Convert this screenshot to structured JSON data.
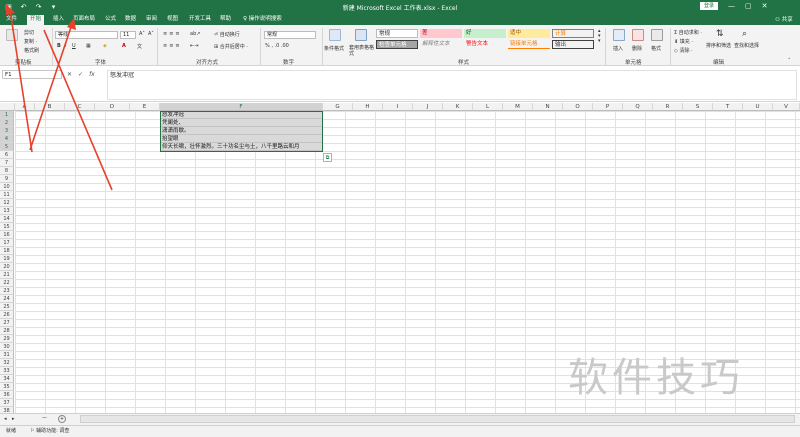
{
  "titlebar": {
    "title": "新建 Microsoft Excel 工作表.xlsx  -  Excel",
    "login": "登录",
    "minimize": "—",
    "restore": "▢",
    "close": "✕"
  },
  "tabs": [
    "文件",
    "开始",
    "插入",
    "页面布局",
    "公式",
    "数据",
    "审阅",
    "视图",
    "开发工具",
    "帮助",
    "操作说明搜索"
  ],
  "share": "共享",
  "ribbon": {
    "clipboard": {
      "cut": "剪切",
      "copy": "复制 ·",
      "format": "格式刷",
      "label": "剪贴板"
    },
    "font": {
      "name": "等线",
      "size": "11",
      "bold": "B",
      "italic": "I",
      "underline": "U",
      "grow": "A˄",
      "shrink": "A˅",
      "color_a": "A",
      "label": "字体"
    },
    "align": {
      "wrap": "自动换行",
      "merge": "合并后居中 ·",
      "label": "对齐方式"
    },
    "number": {
      "format": "常规",
      "label": "数字"
    },
    "styles": {
      "cond": "条件格式",
      "table": "套用表格格式",
      "normal": "常规",
      "bad": "差",
      "good": "好",
      "neutral": "适中",
      "calc": "计算",
      "check": "检查单元格",
      "explain": "解释性文本",
      "warn": "警告文本",
      "link": "链接单元格",
      "output": "输出",
      "label": "样式"
    },
    "cells": {
      "insert": "插入",
      "delete": "删除",
      "format": "格式",
      "label": "单元格"
    },
    "editing": {
      "autosum": "自动求和 ·",
      "fill": "填充 ·",
      "clear": "清除 ·",
      "sort": "排序和筛选",
      "find": "查找和选择",
      "label": "编辑"
    }
  },
  "formula_bar": {
    "name_box": "F1",
    "fx": "fx",
    "content": "怒发冲冠"
  },
  "columns": [
    "A",
    "B",
    "C",
    "D",
    "E",
    "F",
    "G",
    "H",
    "I",
    "J",
    "K",
    "L",
    "M",
    "N",
    "O",
    "P",
    "Q",
    "R",
    "S",
    "T",
    "U",
    "V"
  ],
  "rows": [
    "1",
    "2",
    "3",
    "4",
    "5",
    "6",
    "7",
    "8",
    "9",
    "10",
    "11",
    "12",
    "13",
    "14",
    "15",
    "16",
    "17",
    "18",
    "19",
    "20",
    "21",
    "22",
    "23",
    "24",
    "25",
    "26",
    "27",
    "28",
    "29",
    "30",
    "31",
    "32",
    "33",
    "34",
    "35",
    "36",
    "37",
    "38"
  ],
  "cells_f": [
    "怒发冲冠",
    "凭阑处、",
    "潇潇雨歇。",
    "抬望眼",
    "仰天长啸，壮怀激烈。三十功名尘与土，八千里路云和月"
  ],
  "sheet": {
    "add": "+",
    "name": ""
  },
  "status": {
    "ready": "就绪",
    "accessibility": "辅助功能: 调查"
  },
  "watermark": "软件技巧"
}
